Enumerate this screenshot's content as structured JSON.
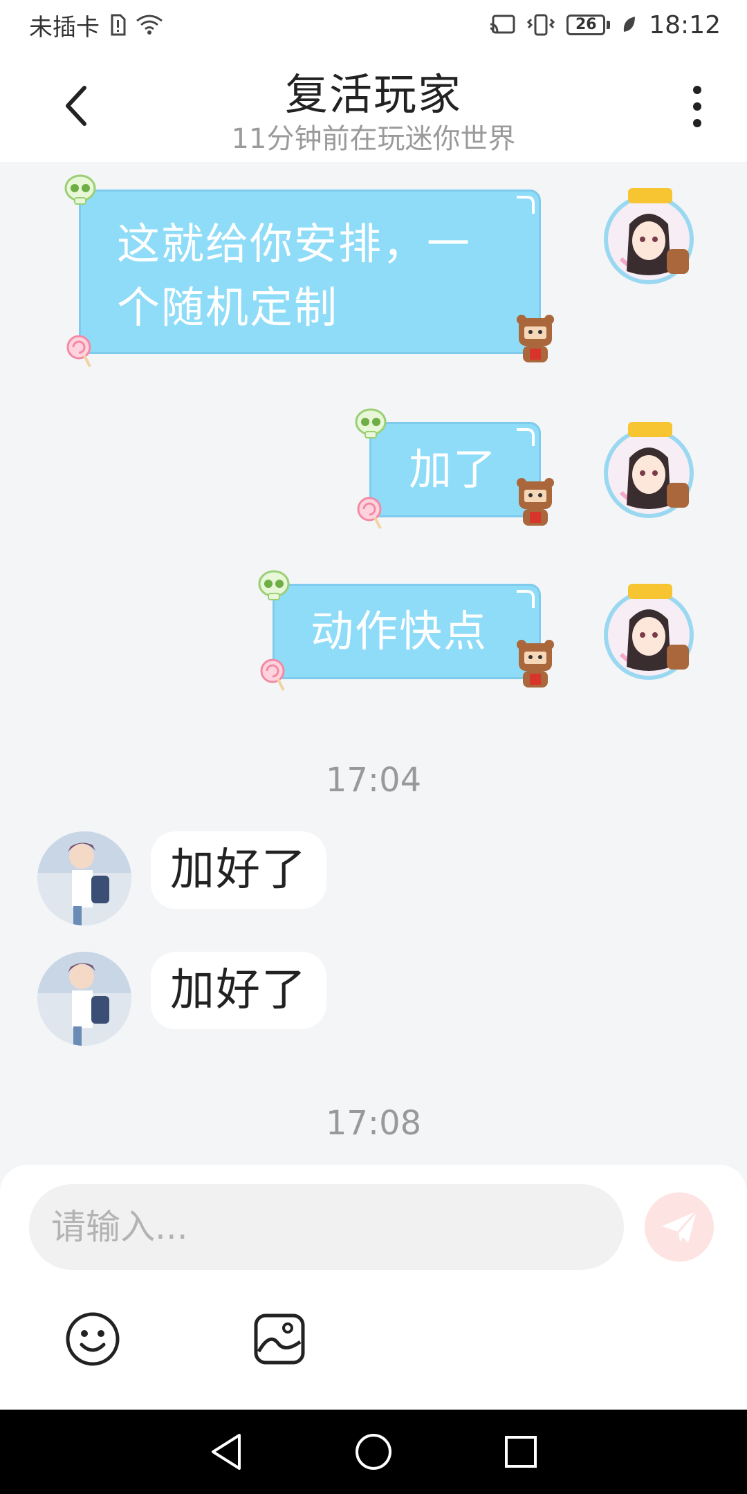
{
  "status_bar": {
    "carrier": "未插卡",
    "battery": "26",
    "time": "18:12"
  },
  "header": {
    "title": "复活玩家",
    "subtitle": "11分钟前在玩迷你世界"
  },
  "messages_sent": [
    {
      "text": "这就给你安排，一个随机定制"
    },
    {
      "text": "加了"
    },
    {
      "text": "动作快点"
    }
  ],
  "timestamps": [
    "17:04",
    "17:08"
  ],
  "messages_received": [
    {
      "text": "加好了"
    },
    {
      "text": "加好了"
    }
  ],
  "input": {
    "placeholder": "请输入..."
  },
  "icons": {
    "back": "chevron-left-icon",
    "more": "more-vertical-icon",
    "send": "send-icon",
    "emoji": "emoji-icon",
    "image": "image-icon"
  },
  "colors": {
    "sent_bubble": "#8fdcf8",
    "send_button": "#fde3e1",
    "background": "#f4f5f7"
  }
}
